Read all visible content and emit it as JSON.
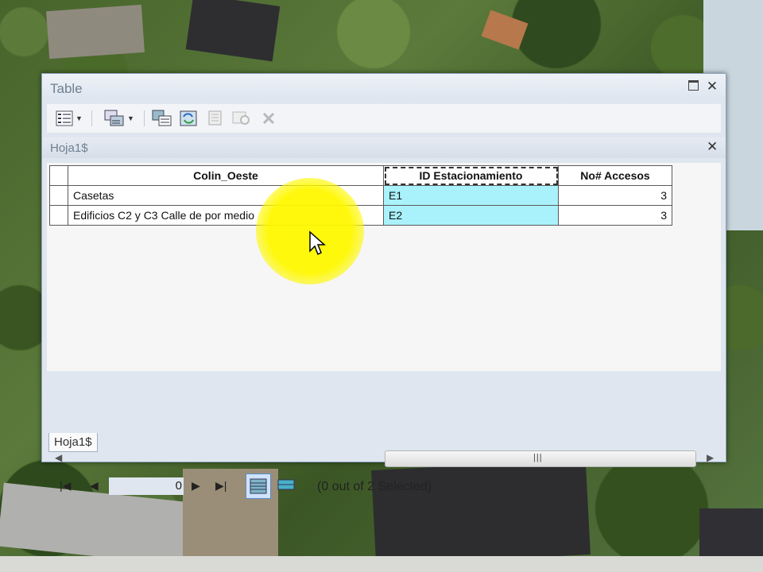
{
  "window": {
    "title": "Table"
  },
  "table_tab": {
    "title": "Hoja1$"
  },
  "grid": {
    "columns": [
      "Colin_Oeste",
      "ID Estacionamiento",
      "No# Accesos"
    ],
    "rows": [
      [
        "Casetas",
        "E1",
        "3"
      ],
      [
        "Edificios C2 y C3 Calle de por medio",
        "E2",
        "3"
      ]
    ]
  },
  "navigation": {
    "record_number": "0",
    "selection_status": "(0 out of 2 Selected)"
  },
  "bottom_tabs": [
    {
      "label": "Hoja1$"
    }
  ],
  "icons": {
    "toolbar": [
      "table-options-icon",
      "related-tables-icon",
      "select-by-attributes-icon",
      "switch-selection-icon",
      "clear-selection-icon",
      "zoom-to-selected-icon",
      "delete-selected-icon"
    ],
    "nav": [
      "first-record-icon",
      "previous-record-icon",
      "next-record-icon",
      "last-record-icon",
      "show-all-records-icon",
      "show-selected-records-icon"
    ]
  },
  "colors": {
    "selected_cell": "#a9f2fb",
    "window_bg": "#dfe6ef",
    "cursor_highlight": "#fff800"
  }
}
